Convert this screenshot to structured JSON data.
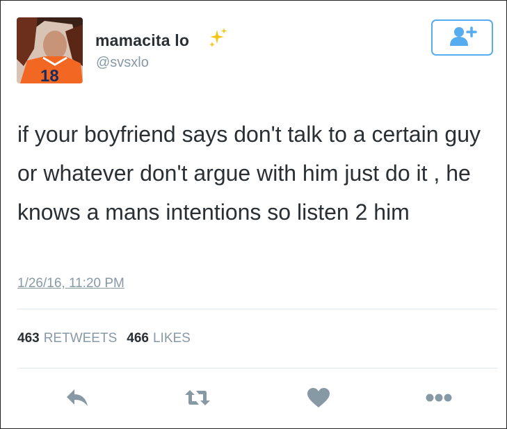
{
  "user": {
    "display_name": "mamacita lo",
    "handle": "@svsxlo",
    "jersey_number": "18"
  },
  "tweet": {
    "text": "if your boyfriend says don't talk to a certain guy or whatever don't argue with him just do it , he knows a mans intentions so listen 2 him",
    "timestamp": "1/26/16, 11:20 PM"
  },
  "stats": {
    "retweets_count": "463",
    "retweets_label": "RETWEETS",
    "likes_count": "466",
    "likes_label": "LIKES"
  },
  "icons": {
    "follow": "add-user-icon",
    "sparkles": "sparkles-icon",
    "reply": "reply-icon",
    "retweet": "retweet-icon",
    "like": "heart-icon",
    "more": "more-icon"
  },
  "colors": {
    "accent": "#55acee",
    "muted": "#8899a6",
    "text": "#292f33",
    "divider": "#e1e8ed"
  }
}
